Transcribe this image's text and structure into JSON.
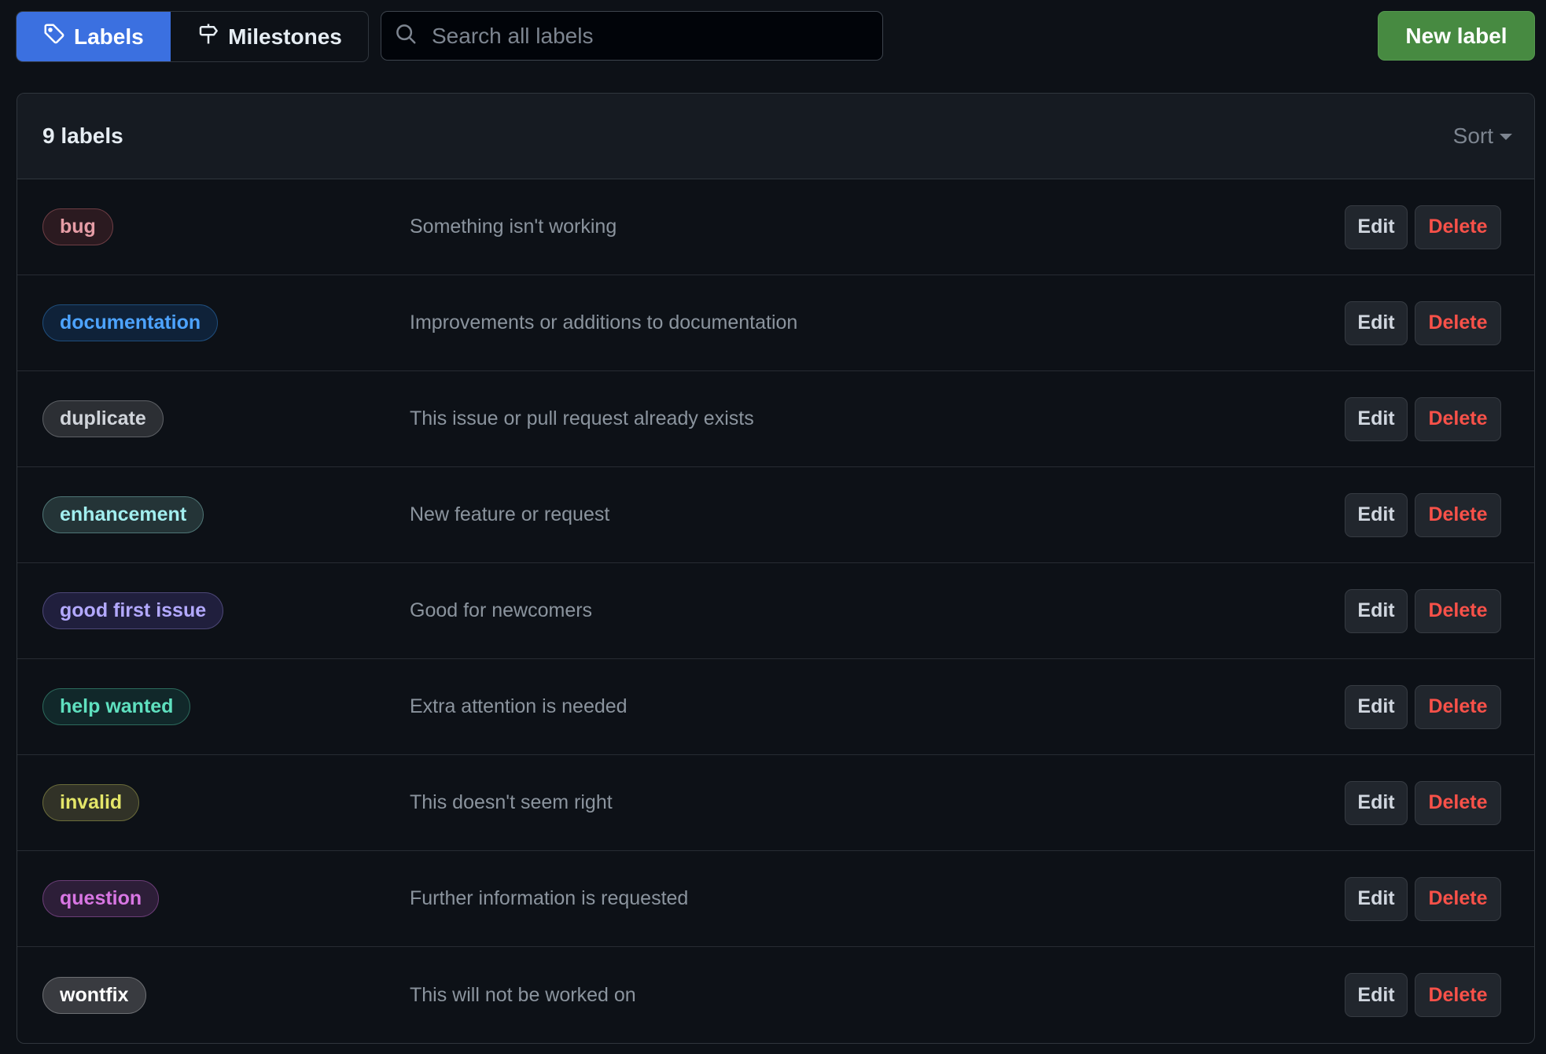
{
  "nav": {
    "tabs": [
      {
        "label": "Labels",
        "icon": "tag-icon",
        "active": true
      },
      {
        "label": "Milestones",
        "icon": "milestone-icon",
        "active": false
      }
    ]
  },
  "search": {
    "placeholder": "Search all labels",
    "value": ""
  },
  "toolbar": {
    "new_label": "New label"
  },
  "list": {
    "count_text": "9 labels",
    "sort_label": "Sort",
    "edit_label": "Edit",
    "delete_label": "Delete",
    "labels": [
      {
        "name": "bug",
        "description": "Something isn't working",
        "text_color": "#e69da6",
        "bg_color": "#2b1a20",
        "border_color": "#6e3e45"
      },
      {
        "name": "documentation",
        "description": "Improvements or additions to documentation",
        "text_color": "#4da3ff",
        "bg_color": "#0f2239",
        "border_color": "#1f4e7d"
      },
      {
        "name": "duplicate",
        "description": "This issue or pull request already exists",
        "text_color": "#d1d5db",
        "bg_color": "#2c2f34",
        "border_color": "#5e6166"
      },
      {
        "name": "enhancement",
        "description": "New feature or request",
        "text_color": "#a2eeef",
        "bg_color": "#243437",
        "border_color": "#4f7676"
      },
      {
        "name": "good first issue",
        "description": "Good for newcomers",
        "text_color": "#b3a9ff",
        "bg_color": "#201f3d",
        "border_color": "#4d4878"
      },
      {
        "name": "help wanted",
        "description": "Extra attention is needed",
        "text_color": "#5fe0bf",
        "bg_color": "#11282a",
        "border_color": "#2c6a5c"
      },
      {
        "name": "invalid",
        "description": "This doesn't seem right",
        "text_color": "#e4e669",
        "bg_color": "#313227",
        "border_color": "#6b6c3a"
      },
      {
        "name": "question",
        "description": "Further information is requested",
        "text_color": "#d876e3",
        "bg_color": "#2d1e38",
        "border_color": "#6b3d77"
      },
      {
        "name": "wontfix",
        "description": "This will not be worked on",
        "text_color": "#ffffff",
        "bg_color": "#393b40",
        "border_color": "#6d6f73"
      }
    ]
  },
  "colors": {
    "accent": "#3b70e0",
    "primary_button": "#478a41",
    "danger": "#f85149",
    "background": "#0d1117"
  }
}
